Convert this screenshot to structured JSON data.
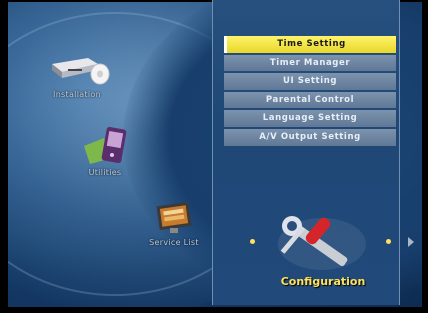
{
  "left_menu": {
    "installation": {
      "label": "Installation",
      "icon": "satellite-receiver-icon"
    },
    "utilities": {
      "label": "Utilities",
      "icon": "pda-device-icon"
    },
    "service_list": {
      "label": "Service List",
      "icon": "tv-screen-icon"
    }
  },
  "menu": {
    "items": [
      {
        "label": "Time Setting",
        "selected": true
      },
      {
        "label": "Timer Manager",
        "selected": false
      },
      {
        "label": "UI Setting",
        "selected": false
      },
      {
        "label": "Parental Control",
        "selected": false
      },
      {
        "label": "Language Setting",
        "selected": false
      },
      {
        "label": "A/V Output Setting",
        "selected": false
      }
    ]
  },
  "section": {
    "title": "Configuration",
    "icon": "tools-wrench-screwdriver-icon"
  },
  "colors": {
    "selected": "#f2e24a",
    "title": "#ffe25a",
    "item_bg": "#6b84a2"
  }
}
